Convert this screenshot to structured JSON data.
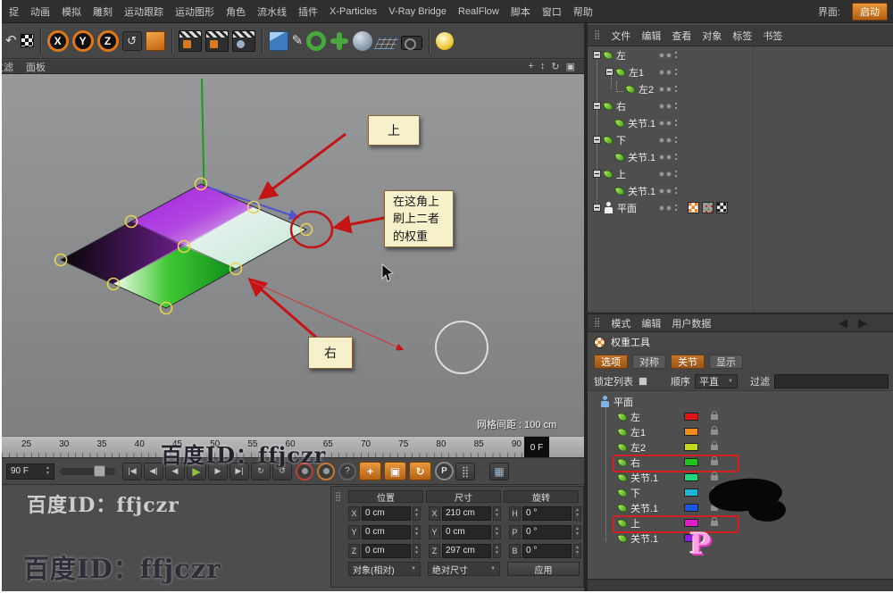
{
  "menubar": {
    "items": [
      "捉",
      "动画",
      "模拟",
      "雕刻",
      "运动跟踪",
      "运动图形",
      "角色",
      "流水线",
      "插件",
      "X-Particles",
      "V-Ray Bridge",
      "RealFlow",
      "脚本",
      "窗口",
      "帮助"
    ],
    "interface_label": "界面:",
    "interface_button": "启动"
  },
  "icons": {
    "undo": "↶",
    "x": "X",
    "y": "Y",
    "z": "Z",
    "workplane": "↺",
    "pen": "✎",
    "pan": "+",
    "dolly": "↕",
    "orbit": "↻",
    "maximize": "▣",
    "goto_start": "|◀",
    "prev_key": "◀|",
    "prev_frame": "◀",
    "play": "▶",
    "next_frame": "▶",
    "goto_end": "▶|",
    "loop": "↻",
    "loop2": "↺",
    "help": "?",
    "p": "P",
    "move": "+",
    "scale": "▣",
    "rotate": "↻",
    "dots": "⣿",
    "view": "▦",
    "grid": "⣿",
    "up": "▲",
    "down": "▼",
    "dd": "▼",
    "tri_l": "◀",
    "tri_r": "▶"
  },
  "viewport": {
    "menu": [
      "过滤",
      "面板"
    ],
    "grid_label": "网格间距 : 100 cm",
    "notes": {
      "top": "上",
      "corner": "在这角上刷上二者的权重",
      "right": "右"
    }
  },
  "timeline": {
    "ticks": [
      "25",
      "30",
      "35",
      "40",
      "45",
      "50",
      "55",
      "60",
      "65",
      "70",
      "75",
      "80",
      "85",
      "90"
    ],
    "current_frame": "0 F",
    "end_frame": "90 F"
  },
  "object_manager": {
    "menu": [
      "文件",
      "编辑",
      "查看",
      "对象",
      "标签",
      "书签"
    ],
    "items": [
      "左",
      "左1",
      "左2",
      "右",
      "关节.1",
      "下",
      "关节.1",
      "上",
      "关节.1",
      "平面"
    ]
  },
  "attributes": {
    "menu": [
      "模式",
      "编辑",
      "用户数据"
    ],
    "tool_title": "权重工具",
    "tabs": [
      "选项",
      "对称",
      "关节",
      "显示"
    ],
    "lock_label": "锁定列表",
    "order_label": "顺序",
    "order_value": "平直",
    "filter_label": "过滤",
    "root_label": "平面",
    "joints": [
      {
        "label": "左",
        "color": "#e31515"
      },
      {
        "label": "左1",
        "color": "#f08b1c"
      },
      {
        "label": "左2",
        "color": "#c0d91c"
      },
      {
        "label": "右",
        "color": "#21c21c"
      },
      {
        "label": "关节.1",
        "color": "#1cd97a"
      },
      {
        "label": "下",
        "color": "#1cb4d9"
      },
      {
        "label": "关节.1",
        "color": "#1c57e3"
      },
      {
        "label": "上",
        "color": "#e31cc9"
      },
      {
        "label": "关节.1",
        "color": "#8c1ce3"
      }
    ]
  },
  "coords": {
    "groups": [
      {
        "title": "位置"
      },
      {
        "title": "尺寸"
      },
      {
        "title": "旋转"
      }
    ],
    "rows": [
      {
        "p_label": "X",
        "p_value": "0 cm",
        "s_label": "X",
        "s_value": "210 cm",
        "r_label": "H",
        "r_value": "0 °"
      },
      {
        "p_label": "Y",
        "p_value": "0 cm",
        "s_label": "Y",
        "s_value": "0 cm",
        "r_label": "P",
        "r_value": "0 °"
      },
      {
        "p_label": "Z",
        "p_value": "0 cm",
        "s_label": "Z",
        "s_value": "297 cm",
        "r_label": "B",
        "r_value": "0 °"
      }
    ],
    "mode_object": "对象(相对)",
    "mode_size": "绝对尺寸",
    "apply_label": "应用"
  },
  "watermark": {
    "text": "百度ID：ffjczr",
    "letter": "P"
  },
  "colors": {
    "accent_orange": "#e07818",
    "annotation_red": "#c41414",
    "note_bg": "#f6f1cb"
  }
}
